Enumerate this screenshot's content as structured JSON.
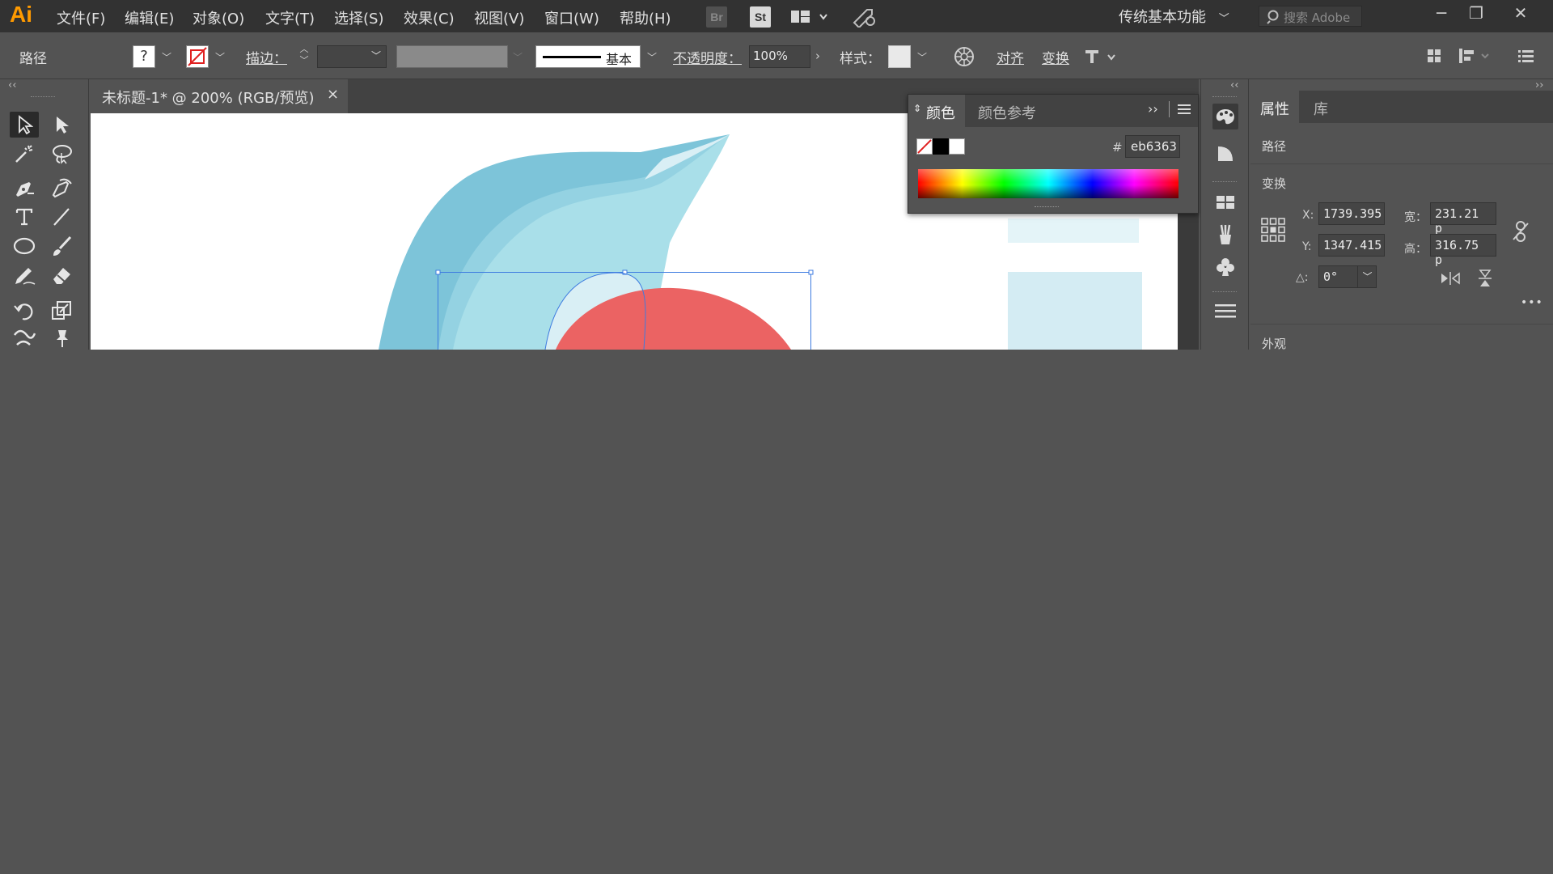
{
  "app": {
    "logo": "Ai"
  },
  "menu": [
    "文件(F)",
    "编辑(E)",
    "对象(O)",
    "文字(T)",
    "选择(S)",
    "效果(C)",
    "视图(V)",
    "窗口(W)",
    "帮助(H)"
  ],
  "bridge_badge": "Br",
  "stock_badge": "St",
  "workspace": "传统基本功能",
  "search": {
    "placeholder": "搜索 Adobe"
  },
  "control": {
    "object_type": "路径",
    "fill_question": "?",
    "stroke_label": "描边：",
    "stroke_profile": "基本",
    "opacity_label": "不透明度：",
    "opacity_value": "100%",
    "style_label": "样式：",
    "align_link": "对齐",
    "transform_link": "变换"
  },
  "document": {
    "tab_title": "未标题-1* @ 200% (RGB/预览)",
    "close": "×"
  },
  "color_panel": {
    "tabs": [
      "颜色",
      "颜色参考"
    ],
    "hex_prefix": "#",
    "hex_value": "eb6363",
    "colors": {
      "fill": "#eb6363",
      "black": "#000000",
      "white": "#ffffff"
    }
  },
  "properties": {
    "tabs": [
      "属性",
      "库"
    ],
    "section_type": "路径",
    "section_transform": "变换",
    "x_label": "X:",
    "x_value": "1739.395",
    "y_label": "Y:",
    "y_value": "1347.415",
    "w_label": "宽：",
    "w_value": "231.21 p",
    "h_label": "高：",
    "h_value": "316.75 p",
    "angle_label": "△:",
    "angle_value": "0°",
    "more": "•••",
    "section_appearance": "外观"
  },
  "artwork_colors": {
    "blue_dark": "#7dc4d9",
    "blue_mid": "#94d2e2",
    "blue_light": "#a9dfe9",
    "blue_pale": "#d9eff5",
    "red": "#eb6363"
  }
}
